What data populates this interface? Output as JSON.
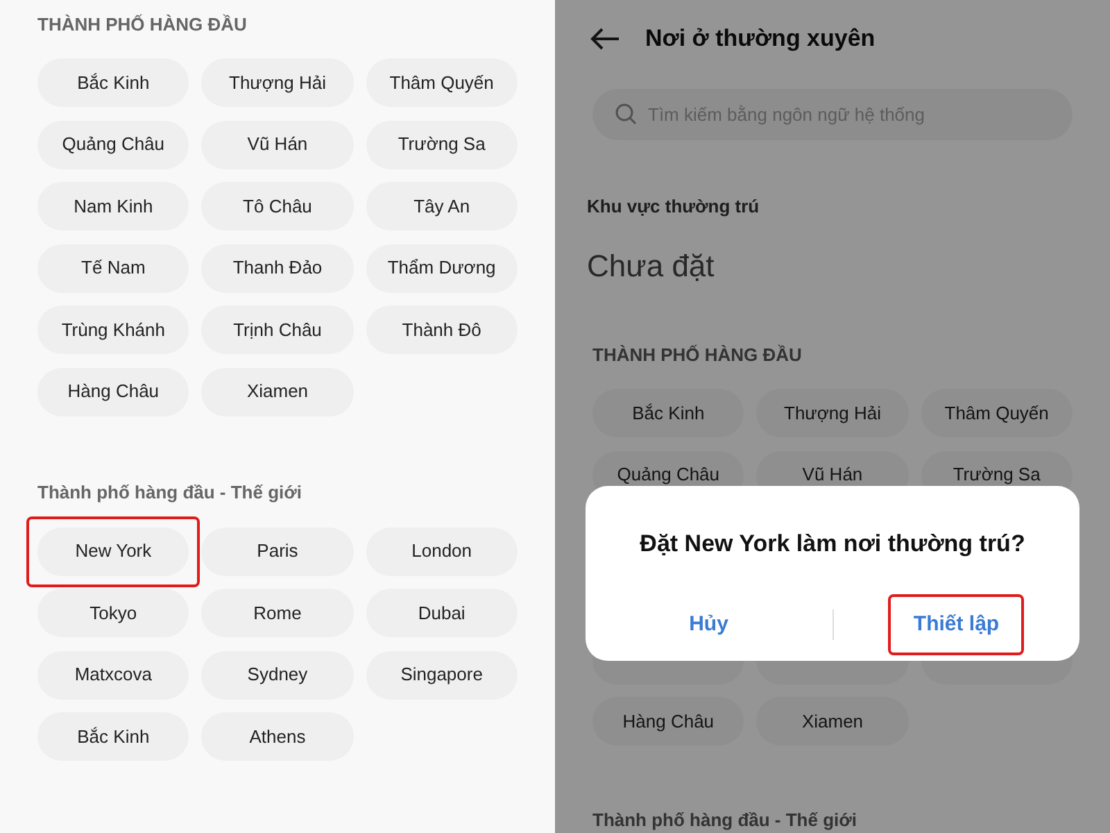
{
  "left": {
    "top_cities": {
      "title": "THÀNH PHỐ HÀNG ĐẦU",
      "cities": [
        {
          "label": "Bắc Kinh",
          "highlighted": false
        },
        {
          "label": "Thượng Hải",
          "highlighted": false
        },
        {
          "label": "Thâm Quyến",
          "highlighted": false
        },
        {
          "label": "Quảng Châu",
          "highlighted": false
        },
        {
          "label": "Vũ Hán",
          "highlighted": false
        },
        {
          "label": "Trường Sa",
          "highlighted": false
        },
        {
          "label": "Nam Kinh",
          "highlighted": false
        },
        {
          "label": "Tô Châu",
          "highlighted": false
        },
        {
          "label": "Tây An",
          "highlighted": false
        },
        {
          "label": "Tế Nam",
          "highlighted": false
        },
        {
          "label": "Thanh Đảo",
          "highlighted": false
        },
        {
          "label": "Thẩm Dương",
          "highlighted": false
        },
        {
          "label": "Trùng Khánh",
          "highlighted": false
        },
        {
          "label": "Trịnh Châu",
          "highlighted": false
        },
        {
          "label": "Thành Đô",
          "highlighted": false
        },
        {
          "label": "Hàng Châu",
          "highlighted": false
        },
        {
          "label": "Xiamen",
          "highlighted": false
        }
      ]
    },
    "world_cities": {
      "title": "Thành phố hàng đầu - Thế giới",
      "cities": [
        {
          "label": "New York",
          "highlighted": true
        },
        {
          "label": "Paris",
          "highlighted": false
        },
        {
          "label": "London",
          "highlighted": false
        },
        {
          "label": "Tokyo",
          "highlighted": false
        },
        {
          "label": "Rome",
          "highlighted": false
        },
        {
          "label": "Dubai",
          "highlighted": false
        },
        {
          "label": "Matxcova",
          "highlighted": false
        },
        {
          "label": "Sydney",
          "highlighted": false
        },
        {
          "label": "Singapore",
          "highlighted": false
        },
        {
          "label": "Bắc Kinh",
          "highlighted": false
        },
        {
          "label": "Athens",
          "highlighted": false
        }
      ]
    }
  },
  "right": {
    "title": "Nơi ở thường xuyên",
    "search": {
      "placeholder": "Tìm kiếm bằng ngôn ngữ hệ thống"
    },
    "residence": {
      "label": "Khu vực thường trú",
      "value": "Chưa đặt"
    },
    "top_cities": {
      "title": "THÀNH PHỐ HÀNG ĐẦU",
      "cities_above_dialog": [
        {
          "label": "Bắc Kinh"
        },
        {
          "label": "Thượng Hải"
        },
        {
          "label": "Thâm Quyến"
        },
        {
          "label": "Quảng Châu"
        },
        {
          "label": "Vũ Hán"
        },
        {
          "label": "Trường Sa"
        }
      ],
      "cities_below_dialog": [
        {
          "label": "Hàng Châu"
        },
        {
          "label": "Xiamen"
        }
      ]
    },
    "world_cities_title": "Thành phố hàng đầu - Thế giới",
    "dialog": {
      "message": "Đặt New York làm nơi thường trú?",
      "buttons": [
        {
          "label": "Hủy",
          "highlighted": false
        },
        {
          "label": "Thiết lập",
          "highlighted": true
        }
      ]
    }
  }
}
